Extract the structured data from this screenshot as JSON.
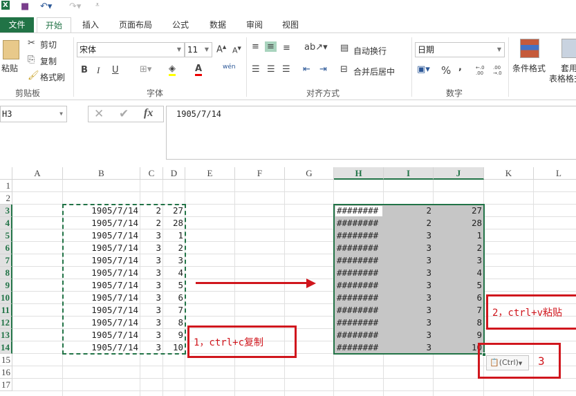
{
  "qat": {
    "app_icon": "excel-icon",
    "save": "save-icon",
    "undo": "undo-icon",
    "redo": "redo-icon",
    "customize": "customize-icon"
  },
  "tabs": [
    "文件",
    "开始",
    "插入",
    "页面布局",
    "公式",
    "数据",
    "审阅",
    "视图"
  ],
  "ribbon": {
    "clipboard": {
      "paste": "粘贴",
      "cut": "剪切",
      "copy": "复制",
      "format_painter": "格式刷",
      "label": "剪贴板"
    },
    "font": {
      "name": "宋体",
      "size": "11",
      "bold": "B",
      "italic": "I",
      "underline": "U",
      "label": "字体",
      "phonetic": "wén"
    },
    "alignment": {
      "wrap": "自动换行",
      "merge": "合并后居中",
      "label": "对齐方式"
    },
    "number": {
      "format": "日期",
      "percent": "%",
      "comma": ",",
      "inc": "←.0 .00",
      "dec": ".00 →.0",
      "label": "数字"
    },
    "styles": {
      "conditional": "条件格式",
      "table_line1": "套用",
      "table_line2": "表格格式"
    }
  },
  "formula_bar": {
    "name_box": "H3",
    "fx": "fx",
    "content": "1905/7/14"
  },
  "columns": [
    "A",
    "B",
    "C",
    "D",
    "E",
    "F",
    "G",
    "H",
    "I",
    "J",
    "K",
    "L"
  ],
  "selected_columns": [
    "H",
    "I",
    "J"
  ],
  "rows": [
    "1",
    "2",
    "3",
    "4",
    "5",
    "6",
    "7",
    "8",
    "9",
    "10",
    "11",
    "12",
    "13",
    "14",
    "15",
    "16",
    "17"
  ],
  "source_data": [
    [
      "1905/7/14",
      "2",
      "27"
    ],
    [
      "1905/7/14",
      "2",
      "28"
    ],
    [
      "1905/7/14",
      "3",
      "1"
    ],
    [
      "1905/7/14",
      "3",
      "2"
    ],
    [
      "1905/7/14",
      "3",
      "3"
    ],
    [
      "1905/7/14",
      "3",
      "4"
    ],
    [
      "1905/7/14",
      "3",
      "5"
    ],
    [
      "1905/7/14",
      "3",
      "6"
    ],
    [
      "1905/7/14",
      "3",
      "7"
    ],
    [
      "1905/7/14",
      "3",
      "8"
    ],
    [
      "1905/7/14",
      "3",
      "9"
    ],
    [
      "1905/7/14",
      "3",
      "10"
    ]
  ],
  "pasted_data": [
    [
      "########",
      "2",
      "27"
    ],
    [
      "########",
      "2",
      "28"
    ],
    [
      "########",
      "3",
      "1"
    ],
    [
      "########",
      "3",
      "2"
    ],
    [
      "########",
      "3",
      "3"
    ],
    [
      "########",
      "3",
      "4"
    ],
    [
      "########",
      "3",
      "5"
    ],
    [
      "########",
      "3",
      "6"
    ],
    [
      "########",
      "3",
      "7"
    ],
    [
      "########",
      "3",
      "8"
    ],
    [
      "########",
      "3",
      "9"
    ],
    [
      "########",
      "3",
      "10"
    ]
  ],
  "annotations": {
    "step1": "1，ctrl+c复制",
    "step2": "2，ctrl+v粘贴",
    "step3": "3",
    "paste_options": "(Ctrl)"
  },
  "colors": {
    "accent": "#217346",
    "annotation": "#d0161d",
    "selection": "#c6c6c6"
  }
}
